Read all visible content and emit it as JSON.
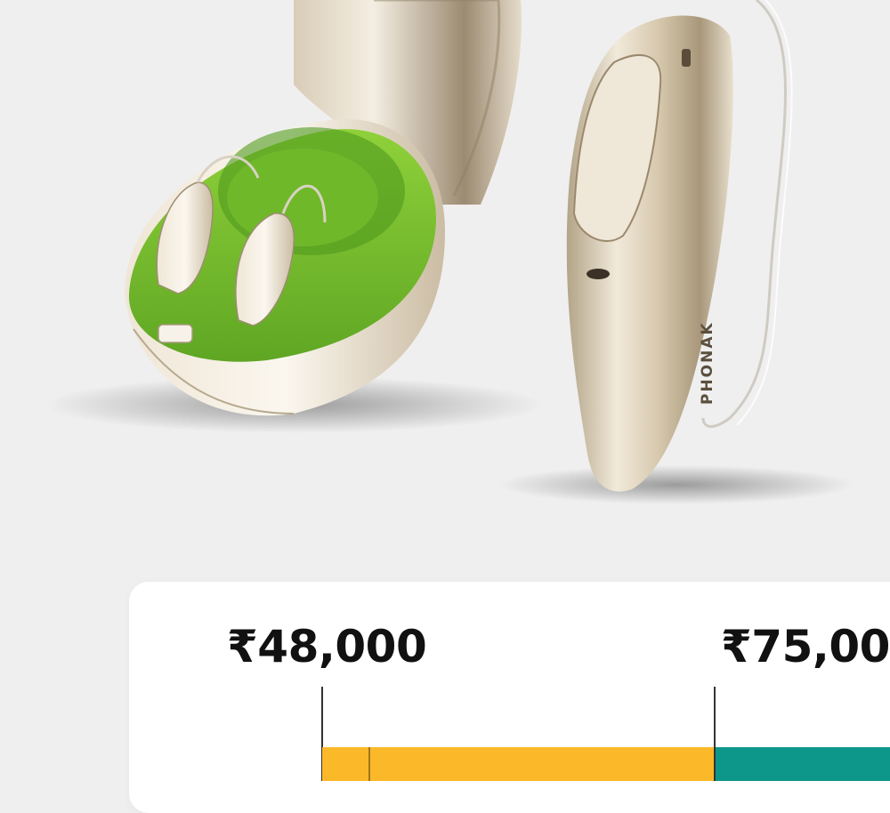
{
  "product": {
    "brand_text": "PHONAK",
    "case_color": "#7cbf2e",
    "device_color": "#d9cbb2"
  },
  "price_range": {
    "low_label": "₹48,000",
    "high_label": "₹75,00",
    "low_color": "#fbb829",
    "high_color": "#0d968a"
  }
}
